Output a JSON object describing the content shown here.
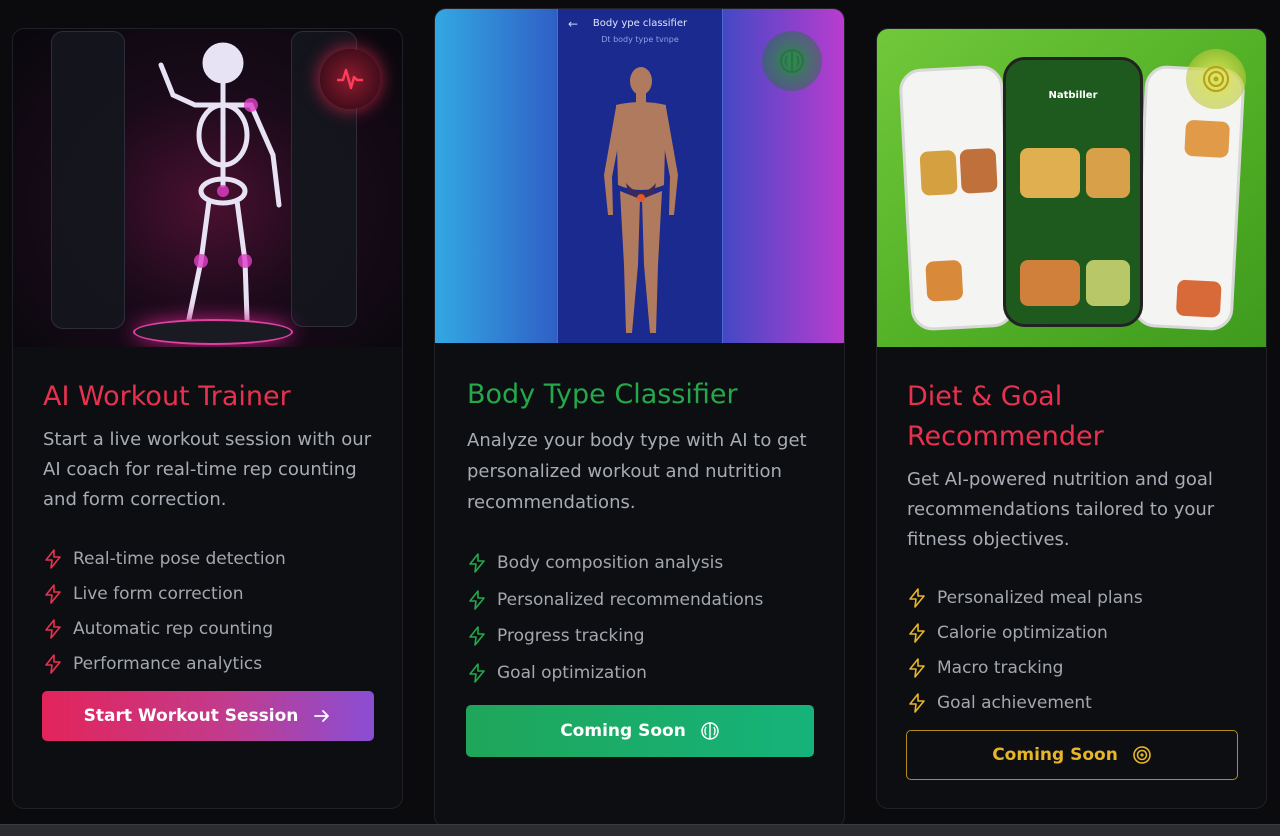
{
  "cards": [
    {
      "title": "AI Workout Trainer",
      "description": "Start a live workout session with our AI coach for real-time rep counting and form correction.",
      "features": [
        "Real-time pose detection",
        "Live form correction",
        "Automatic rep counting",
        "Performance analytics"
      ],
      "button_label": "Start Workout Session",
      "badge_icon": "heartbeat-icon",
      "accent": "#e8314f"
    },
    {
      "title": "Body Type Classifier",
      "description": "Analyze your body type with AI to get personalized workout and nutrition recommendations.",
      "features": [
        "Body composition analysis",
        "Personalized recommendations",
        "Progress tracking",
        "Goal optimization"
      ],
      "button_label": "Coming Soon",
      "badge_icon": "brain-icon",
      "accent": "#24a84a",
      "hero_screen_title": "Body ype classifier",
      "hero_screen_subtitle": "Dt body type tvnpe"
    },
    {
      "title": "Diet & Goal Recommender",
      "description": "Get AI-powered nutrition and goal recommendations tailored to your fitness objectives.",
      "features": [
        "Personalized meal plans",
        "Calorie optimization",
        "Macro tracking",
        "Goal achievement"
      ],
      "button_label": "Coming Soon",
      "badge_icon": "target-icon",
      "accent": "#e6b52a",
      "hero_phone_title": "Natbiller"
    }
  ]
}
